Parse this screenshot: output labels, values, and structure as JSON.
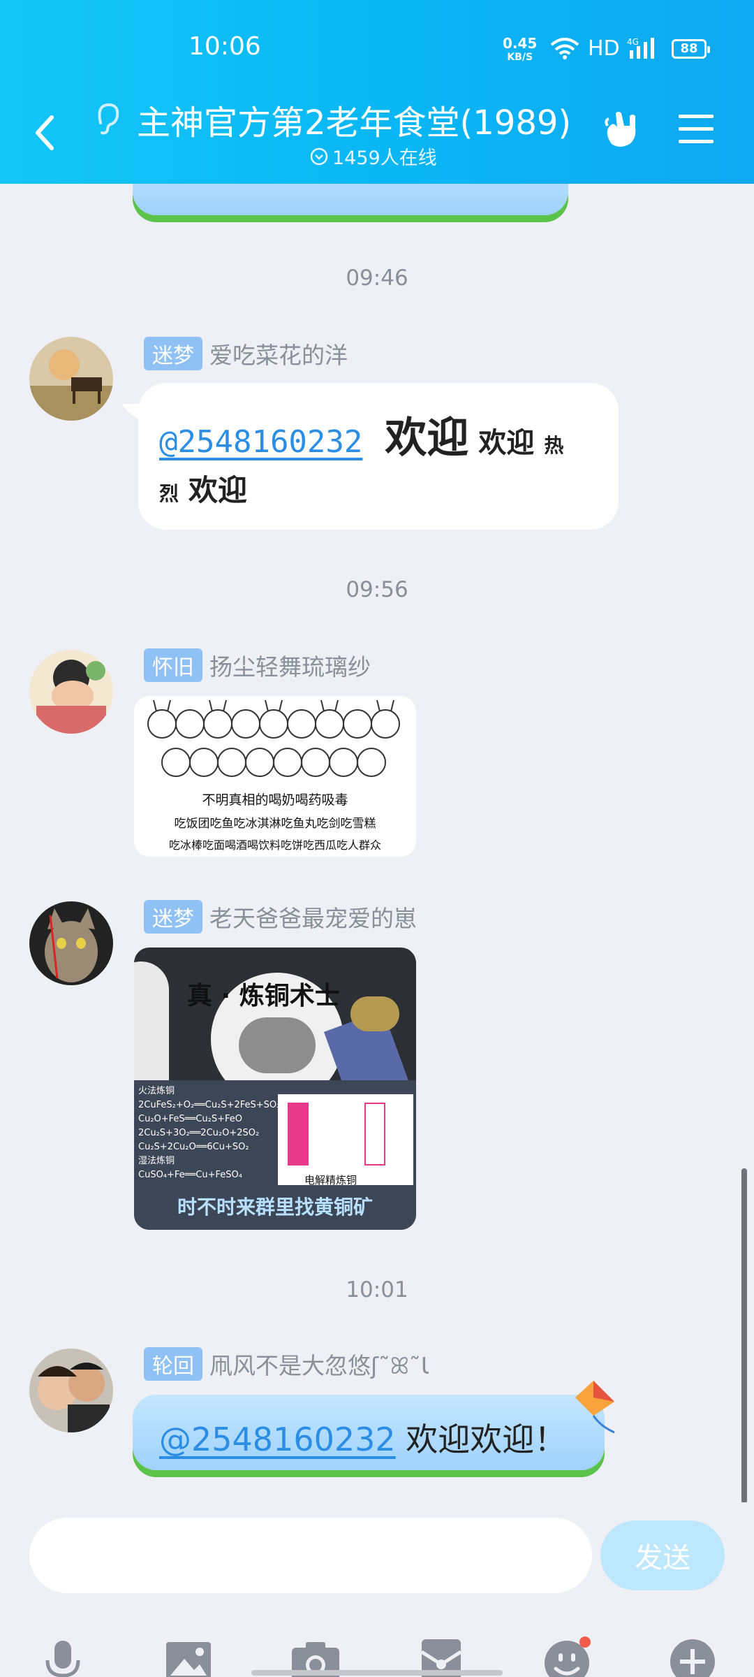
{
  "status": {
    "time": "10:06",
    "net_speed": "0.45",
    "net_unit": "KB/S",
    "hd": "HD",
    "network": "4G",
    "battery": "88"
  },
  "header": {
    "title": "主神官方第2老年食堂(1989)",
    "online": "1459人在线"
  },
  "messages": {
    "ts1": "09:46",
    "m1": {
      "badge": "迷梦",
      "nick": "爱吃菜花的洋",
      "mention": "@2548160232",
      "text1": "欢迎",
      "text2": "欢迎",
      "text3": "热",
      "text4": "烈",
      "text5": "欢迎"
    },
    "ts2": "09:56",
    "m2": {
      "badge": "怀旧",
      "nick": "扬尘轻舞琉璃纱",
      "img_line1": "不明真相的喝奶喝药吸毒",
      "img_line2": "吃饭团吃鱼吃冰淇淋吃鱼丸吃剑吃雪糕",
      "img_line3": "吃冰棒吃面喝酒喝饮料吃饼吃西瓜吃人群众"
    },
    "m3": {
      "badge": "迷梦",
      "nick": "老天爸爸最宠爱的崽",
      "img_title": "真 · 炼铜术士",
      "img_left1": "火法炼铜",
      "img_left2": "2CuFeS₂+O₂══Cu₂S+2FeS+SO₂",
      "img_left3": "Cu₂O+FeS══Cu₂S+FeO",
      "img_left4": "2Cu₂S+3O₂══2Cu₂O+2SO₂",
      "img_left5": "Cu₂S+2Cu₂O══6Cu+SO₂",
      "img_left6": "湿法炼铜",
      "img_left7": "CuSO₄+Fe══Cu+FeSO₄",
      "img_right": "电解精炼铜",
      "img_caption": "时不时来群里找黄铜矿"
    },
    "ts3": "10:01",
    "m4": {
      "badge": "轮回",
      "nick": "凧风不是大忽悠ʃ˜ꕤ˜Ɩ",
      "mention": "@2548160232",
      "text": " 欢迎欢迎！"
    }
  },
  "input": {
    "placeholder": "",
    "send_label": "发送"
  },
  "colors": {
    "header_start": "#14c6f7",
    "header_end": "#0fa8f2",
    "badge": "#8fc1f4",
    "mention": "#2b8ee4",
    "send_disabled": "#bde7fc"
  },
  "icons": [
    "back-icon",
    "ear-icon",
    "hand-gesture-icon",
    "menu-icon",
    "mic-icon",
    "image-icon",
    "camera-icon",
    "red-packet-icon",
    "emoji-icon",
    "plus-icon"
  ]
}
